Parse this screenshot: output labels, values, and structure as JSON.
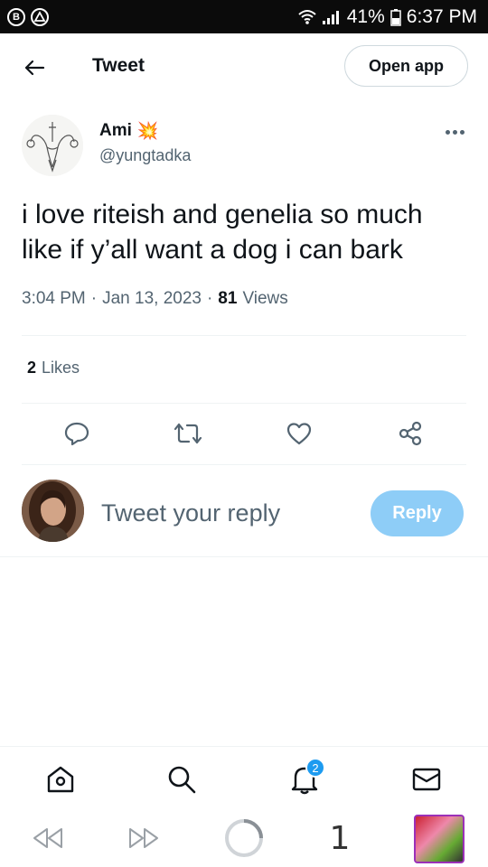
{
  "status_bar": {
    "left_icons": [
      "b-circle-icon",
      "warning-triangle-icon"
    ],
    "battery": "41%",
    "time": "6:37 PM"
  },
  "header": {
    "title": "Tweet",
    "open_app_label": "Open app"
  },
  "author": {
    "name": "Ami",
    "emoji": "💥",
    "handle": "@yungtadka"
  },
  "tweet": {
    "text_line1": "i love riteish and genelia so much",
    "text_line2": "like if y’all want a dog i can bark",
    "time": "3:04 PM",
    "sep": "·",
    "date": "Jan 13, 2023",
    "views_count": "81",
    "views_label": "Views"
  },
  "stats": {
    "likes_count": "2",
    "likes_label": "Likes"
  },
  "reply": {
    "placeholder": "Tweet your reply",
    "button_label": "Reply"
  },
  "bottom_nav": {
    "notifications_badge": "2"
  },
  "browser": {
    "tab_count": "1"
  },
  "colors": {
    "accent": "#1d9bf0",
    "reply_button": "#8ecdf7",
    "secondary_text": "#536471",
    "primary_text": "#0f1419"
  }
}
